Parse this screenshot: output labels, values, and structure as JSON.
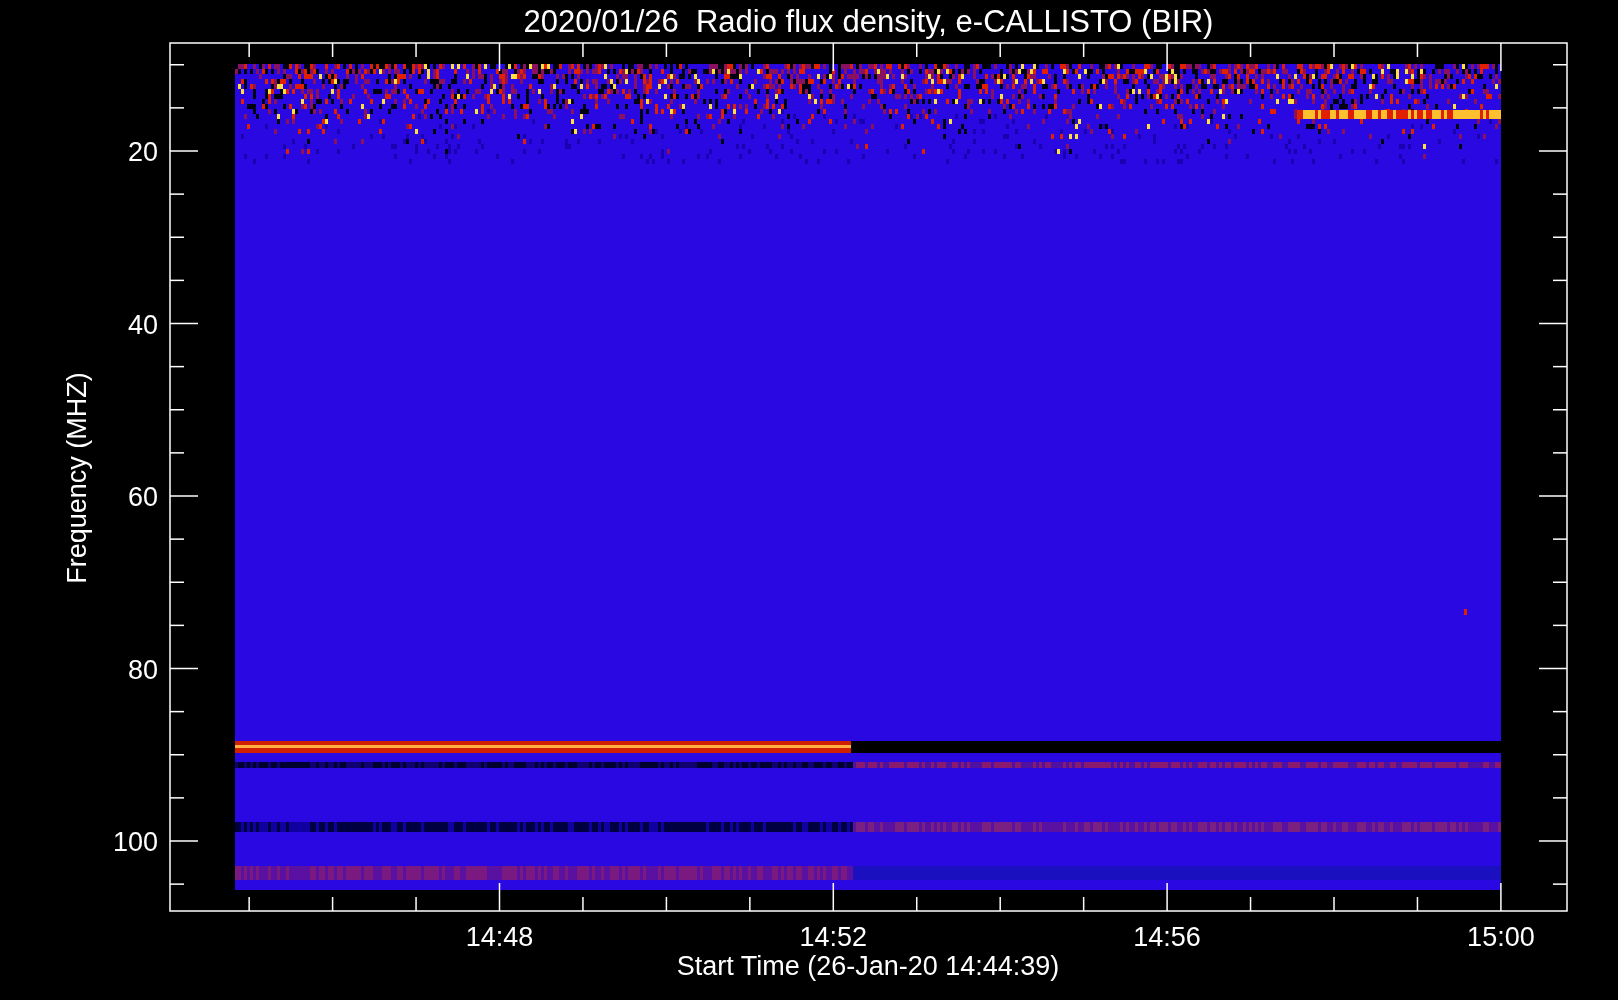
{
  "title": "2020/01/26  Radio flux density, e-CALLISTO (BIR)",
  "y_axis": {
    "label": "Frequency (MHZ)",
    "tick_labels": [
      "20",
      "40",
      "60",
      "80",
      "100"
    ]
  },
  "x_axis": {
    "label": "Start Time (26-Jan-20 14:44:39)",
    "tick_labels": [
      "14:48",
      "14:52",
      "14:56",
      "15:00"
    ]
  }
}
